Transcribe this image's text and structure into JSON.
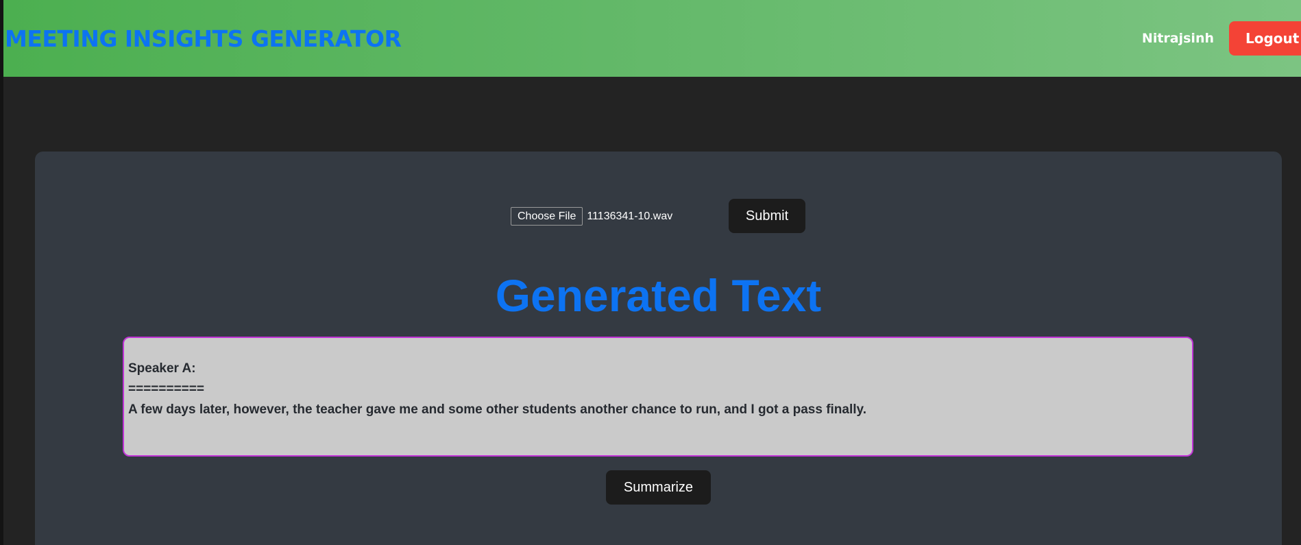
{
  "navbar": {
    "title": "MEETING INSIGHTS GENERATOR",
    "username": "Nitrajsinh",
    "logout_label": "Logout"
  },
  "upload": {
    "choose_file_label": "Choose File",
    "file_name": "11136341-10.wav",
    "submit_label": "Submit"
  },
  "result": {
    "heading": "Generated Text",
    "text": "Speaker A:\n==========\nA few days later, however, the teacher gave me and some other students another chance to run, and I got a pass finally."
  },
  "actions": {
    "summarize_label": "Summarize"
  },
  "colors": {
    "accent_blue": "#0d73f2",
    "navbar_green": "#4caf50",
    "logout_red": "#f44336",
    "card_bg": "#343a42",
    "textbox_border": "#c033d6"
  }
}
